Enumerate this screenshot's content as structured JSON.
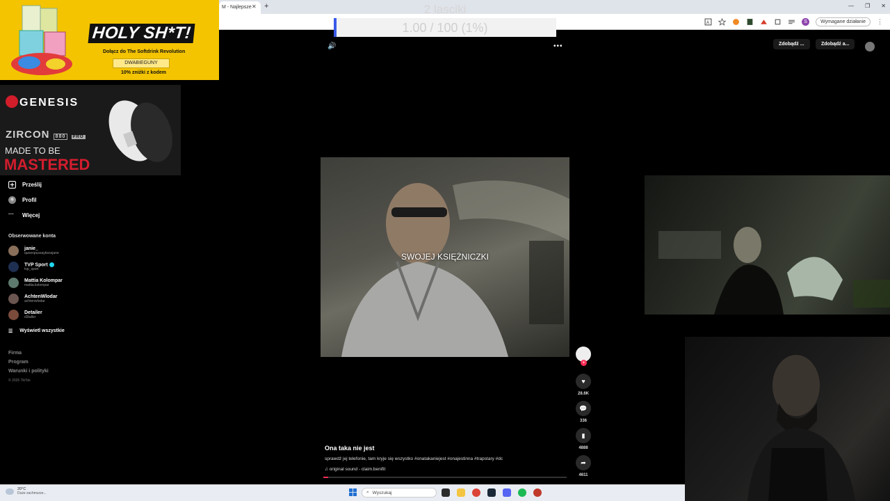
{
  "browser": {
    "tab_title": "M - Najlepsze",
    "tab_close": "✕",
    "new_tab": "+",
    "required_action": "Wymagane działanie",
    "profile_initial": "S",
    "window_controls": [
      "—",
      "❐",
      "✕"
    ]
  },
  "overlay": {
    "goal_title": "2 lasciki",
    "goal_text": "1.00 / 100 (1%)",
    "goal_progress": 0.01
  },
  "ads": {
    "top": {
      "headline": "HOLY SH*T!",
      "sub": "Dołącz do The Softdrink Revolution",
      "code": "DWABIEGUNY",
      "discount": "10% zniżki z kodem",
      "brand_color": "#f4c400"
    },
    "genesis": {
      "logo": "GENESIS",
      "model": "ZIRCON",
      "model_badges": [
        "880",
        "PRO"
      ],
      "tagline": "MADE TO BE",
      "tagline_strong": "MASTERED",
      "accent": "#d31d2e"
    }
  },
  "sidebar": {
    "nav": [
      {
        "label": "Prześlij",
        "icon": "upload-icon"
      },
      {
        "label": "Profil",
        "icon": "profile-icon"
      },
      {
        "label": "Więcej",
        "icon": "more-icon"
      }
    ],
    "following_title": "Obserwowane konta",
    "accounts": [
      {
        "name": "janie_",
        "handle": "queenpussaybossjane",
        "color": "#8a6f5a"
      },
      {
        "name": "TVP Sport",
        "handle": "tvp_sport",
        "color": "#1f2f52",
        "verified": true
      },
      {
        "name": "Mattia Kolompar",
        "handle": "mattia.kolompar",
        "color": "#5e7a6e"
      },
      {
        "name": "AchtenWlodar",
        "handle": "achtenwlodar",
        "color": "#6b5550"
      },
      {
        "name": "Detailer",
        "handle": "d3taller",
        "color": "#7a4a3a"
      }
    ],
    "show_all": "Wyświetl wszystkie",
    "footer": [
      "Firma",
      "Program",
      "Warunki i polityki"
    ],
    "copyright": "© 2026 TikTok"
  },
  "top_actions": {
    "get_app_1": "Zdobądź ...",
    "get_app_2": "Zdobądź a..."
  },
  "video": {
    "subtitle": "SWOJEJ KSIĘŻNICZKI",
    "progress": 0.02
  },
  "rail": {
    "likes": "28.6K",
    "comments": "336",
    "saves": "4888",
    "shares": "4611"
  },
  "caption": {
    "title": "Ona taka nie jest",
    "description": "sprawdź jej telefonie, tam kryje się wszystko #onatakaniejest #onajestinna #trapstary #dc",
    "sound": "original sound - claim.benifit"
  },
  "taskbar": {
    "temp": "20°C",
    "weather": "Duże zachmurze...",
    "search_placeholder": "Wyszukaj"
  },
  "colors": {
    "tiktok_red": "#fe2c55",
    "goal_accent": "#3a5ae8"
  }
}
